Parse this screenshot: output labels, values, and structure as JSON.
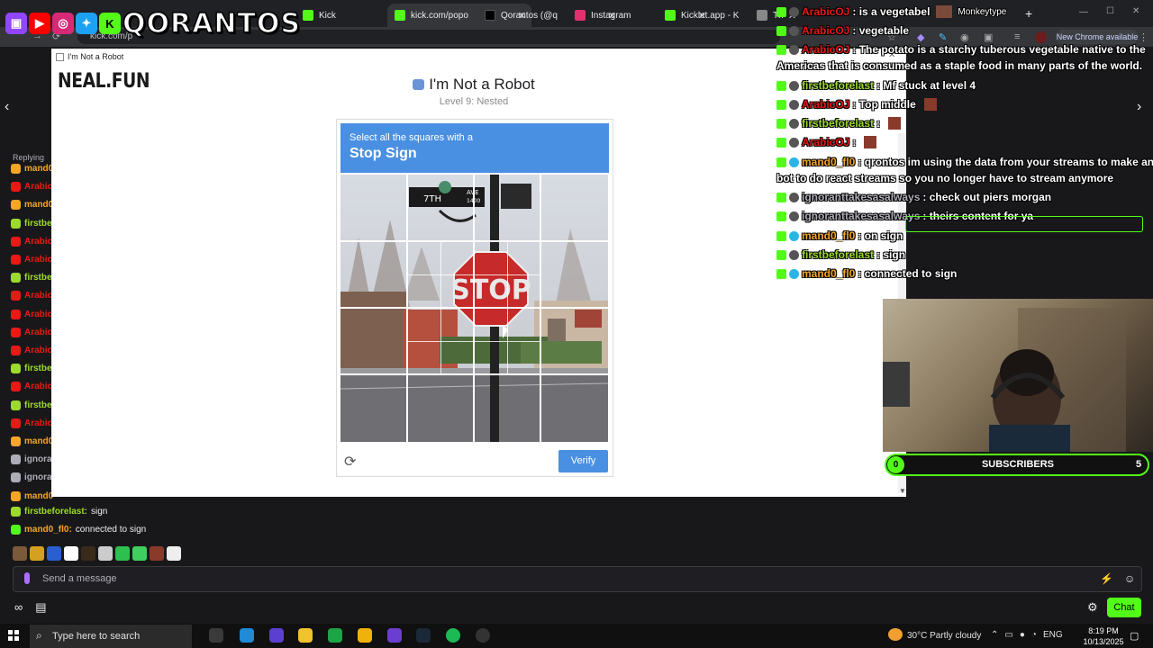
{
  "browser": {
    "tabs": [
      {
        "title": "Kick",
        "color": "#53fc18"
      },
      {
        "title": "kick.com/popo",
        "color": "#53fc18"
      },
      {
        "title": "Qorantos (@q",
        "color": "#111111"
      },
      {
        "title": "Instagram",
        "color": "#e1306c"
      },
      {
        "title": "Kicklet.app - K",
        "color": "#53fc18"
      },
      {
        "title": "Th",
        "color": "#888888"
      }
    ],
    "url": "kick.com/p",
    "new_chrome_label": "New Chrome available",
    "tab_close": "✕",
    "new_tab": "+",
    "window_controls": [
      "—",
      "☐",
      "✕"
    ]
  },
  "overlay": {
    "logo_text": "QORANTOS",
    "social_icons": [
      "twitch-icon",
      "youtube-icon",
      "instagram-icon",
      "twitter-icon",
      "kick-icon"
    ]
  },
  "popup": {
    "window_title": "I'm Not a Robot",
    "site_logo": "NEAL.FUN",
    "heading": "I'm Not a Robot",
    "level": "Level 9: Nested",
    "captcha": {
      "instruction": "Select all the squares with a",
      "target": "Stop Sign",
      "verify_label": "Verify",
      "refresh_icon": "refresh-icon"
    },
    "photo_text": {
      "street_sign_left": "7TH",
      "street_sign_right": "AVE",
      "street_number": "1400",
      "stop_sign": "STOP"
    }
  },
  "left_chat": {
    "replying_label": "Replying",
    "rows": [
      {
        "name": "mand0",
        "color": "#f5a623"
      },
      {
        "name": "Arabic",
        "color": "#e91916"
      },
      {
        "name": "mand0",
        "color": "#f5a623"
      },
      {
        "name": "firstbe",
        "color": "#9cdb2b"
      },
      {
        "name": "Arabic",
        "color": "#e91916"
      },
      {
        "name": "Arabic",
        "color": "#e91916"
      },
      {
        "name": "firstbe",
        "color": "#9cdb2b"
      },
      {
        "name": "Arabic",
        "color": "#e91916"
      },
      {
        "name": "Arabic",
        "color": "#e91916"
      },
      {
        "name": "Arabic",
        "color": "#e91916"
      },
      {
        "name": "Arabic",
        "color": "#e91916"
      },
      {
        "name": "firstbe",
        "color": "#9cdb2b"
      },
      {
        "name": "Arabic",
        "color": "#e91916"
      },
      {
        "name": "firstbe",
        "color": "#9cdb2b"
      },
      {
        "name": "Arabic",
        "color": "#e91916"
      },
      {
        "name": "mand0",
        "color": "#f5a623"
      },
      {
        "name": "ignoranta",
        "color": "#adadb8"
      },
      {
        "name": "ignoranta",
        "color": "#adadb8"
      },
      {
        "name": "mand0",
        "color": "#f5a623"
      }
    ],
    "full_rows": [
      {
        "name": "firstbeforelast:",
        "message": "sign",
        "color": "#9cdb2b"
      },
      {
        "name": "mand0_fl0:",
        "message": "connected to sign",
        "color": "#f5a623"
      }
    ],
    "send_placeholder": "Send a message",
    "chat_button": "Chat"
  },
  "right_chat": {
    "rows": [
      {
        "name": "ArabicOJ",
        "message": ": is a vegetabel",
        "color": "#e91916",
        "extra": "Monkeytype"
      },
      {
        "name": "ArabicOJ",
        "message": ": vegetable",
        "color": "#e91916"
      },
      {
        "name": "ArabicOJ",
        "message": ": The potato is a starchy tuberous vegetable native to the",
        "color": "#e91916"
      },
      {
        "name": "firstbeforelast",
        "message": ": Mf stuck at level 4",
        "color": "#9cdb2b"
      },
      {
        "name": "ArabicOJ",
        "message": ": Top middle",
        "color": "#e91916"
      },
      {
        "name": "firstbeforelast",
        "message": ":",
        "color": "#9cdb2b"
      },
      {
        "name": "ArabicOJ",
        "message": ":",
        "color": "#e91916"
      },
      {
        "name": "mand0_fl0",
        "message": ": qrontos im using the data from your streams to make an ai",
        "color": "#f5a623"
      },
      {
        "name": "ignoranttakesasalways",
        "message": ": check out piers morgan",
        "color": "#adadb8"
      },
      {
        "name": "ignoranttakesasalways",
        "message": ": theirs content for ya",
        "color": "#adadb8"
      },
      {
        "name": "mand0_fl0",
        "message": ": on sign",
        "color": "#f5a623"
      },
      {
        "name": "firstbeforelast",
        "message": ": sign",
        "color": "#9cdb2b"
      },
      {
        "name": "mand0_fl0",
        "message": ": connected to sign",
        "color": "#f5a623"
      }
    ],
    "wrap_potato": "Americas that is consumed as a staple food in many parts of the world.",
    "wrap_mand": "bot to do react streams so you no longer have to stream anymore"
  },
  "subs": {
    "label": "SUBSCRIBERS",
    "current": "0",
    "goal": "5"
  },
  "taskbar": {
    "search_placeholder": "Type here to search",
    "weather": "30°C  Partly cloudy",
    "language": "ENG",
    "time": "8:19 PM",
    "date": "10/13/2025"
  }
}
